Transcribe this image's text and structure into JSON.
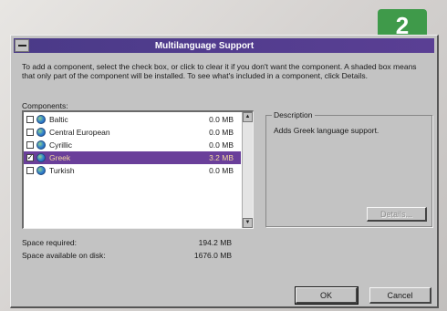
{
  "step_badge": "2",
  "dialog": {
    "title": "Multilanguage Support",
    "instructions": "To add a component, select the check box, or click to clear it if you don't want the component. A shaded box means that only part of the component will be installed. To see what's included in a component, click Details.",
    "components_label": "Components:",
    "components": [
      {
        "name": "Baltic",
        "size": "0.0 MB",
        "checked": false
      },
      {
        "name": "Central European",
        "size": "0.0 MB",
        "checked": false
      },
      {
        "name": "Cyrillic",
        "size": "0.0 MB",
        "checked": false
      },
      {
        "name": "Greek",
        "size": "3.2 MB",
        "checked": true
      },
      {
        "name": "Turkish",
        "size": "0.0 MB",
        "checked": false
      }
    ],
    "description_label": "Description",
    "description_text": "Adds Greek language support.",
    "details_button": "Details...",
    "space_required_label": "Space required:",
    "space_required_value": "194.2 MB",
    "space_available_label": "Space available on disk:",
    "space_available_value": "1676.0 MB",
    "ok_button": "OK",
    "cancel_button": "Cancel"
  },
  "colors": {
    "titlebar": "#4a3a88",
    "selection": "#6a3f9a",
    "badge": "#3f9a4a"
  },
  "icons": [
    "system-menu-icon",
    "globe-icon",
    "scroll-up-arrow-icon",
    "scroll-down-arrow-icon"
  ]
}
